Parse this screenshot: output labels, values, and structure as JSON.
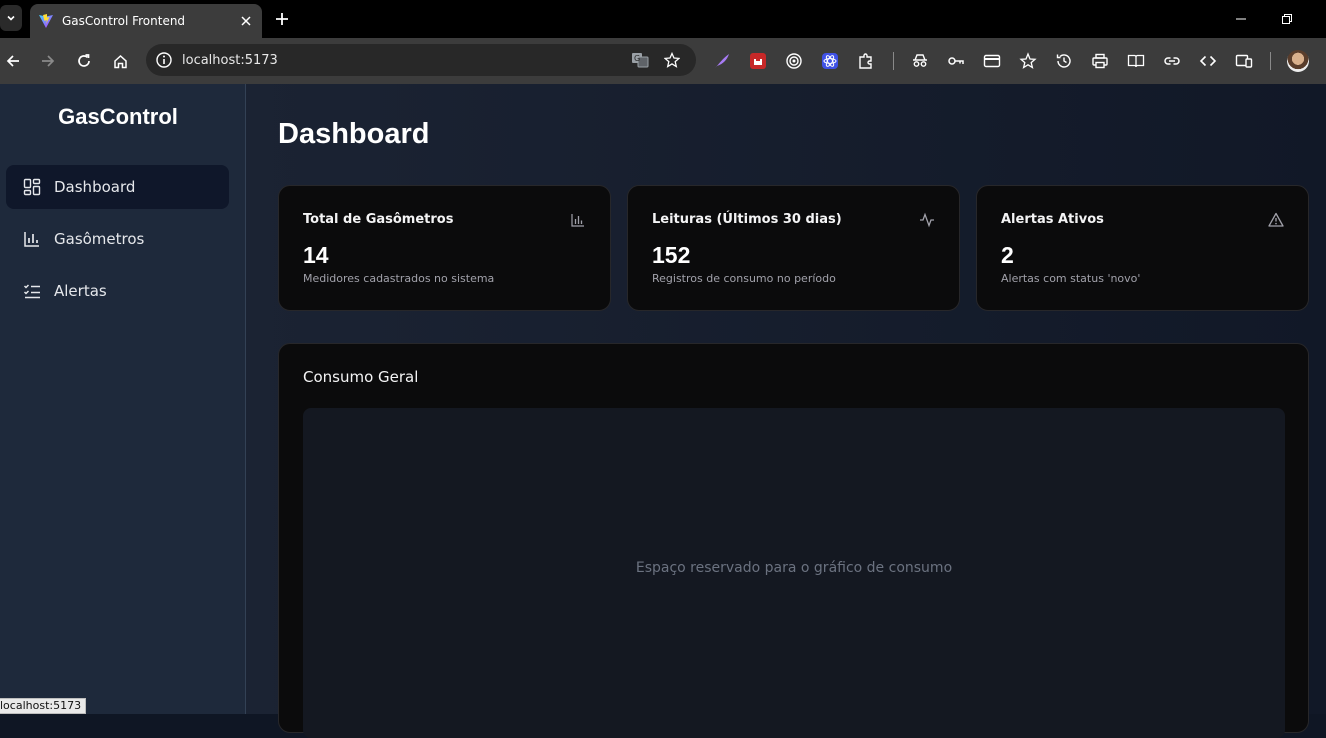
{
  "browser": {
    "tab_title": "GasControl Frontend",
    "url": "localhost:5173",
    "status_url": "localhost:5173"
  },
  "sidebar": {
    "brand": "GasControl",
    "items": [
      {
        "label": "Dashboard",
        "icon": "dashboard-grid-icon",
        "active": true
      },
      {
        "label": "Gasômetros",
        "icon": "bar-chart-icon",
        "active": false
      },
      {
        "label": "Alertas",
        "icon": "checklist-icon",
        "active": false
      }
    ]
  },
  "main": {
    "title": "Dashboard",
    "cards": [
      {
        "title": "Total de Gasômetros",
        "value": "14",
        "subtitle": "Medidores cadastrados no sistema",
        "icon": "bar-chart-icon"
      },
      {
        "title": "Leituras (Últimos 30 dias)",
        "value": "152",
        "subtitle": "Registros de consumo no período",
        "icon": "activity-icon"
      },
      {
        "title": "Alertas Ativos",
        "value": "2",
        "subtitle": "Alertas com status 'novo'",
        "icon": "warning-triangle-icon"
      }
    ],
    "consumption": {
      "title": "Consumo Geral",
      "placeholder": "Espaço reservado para o gráfico de consumo"
    }
  },
  "colors": {
    "sidebar_bg": "#1e293b",
    "active_item_bg": "#0f172a",
    "card_bg": "#0b0b0c",
    "chart_area_bg": "#141821"
  }
}
